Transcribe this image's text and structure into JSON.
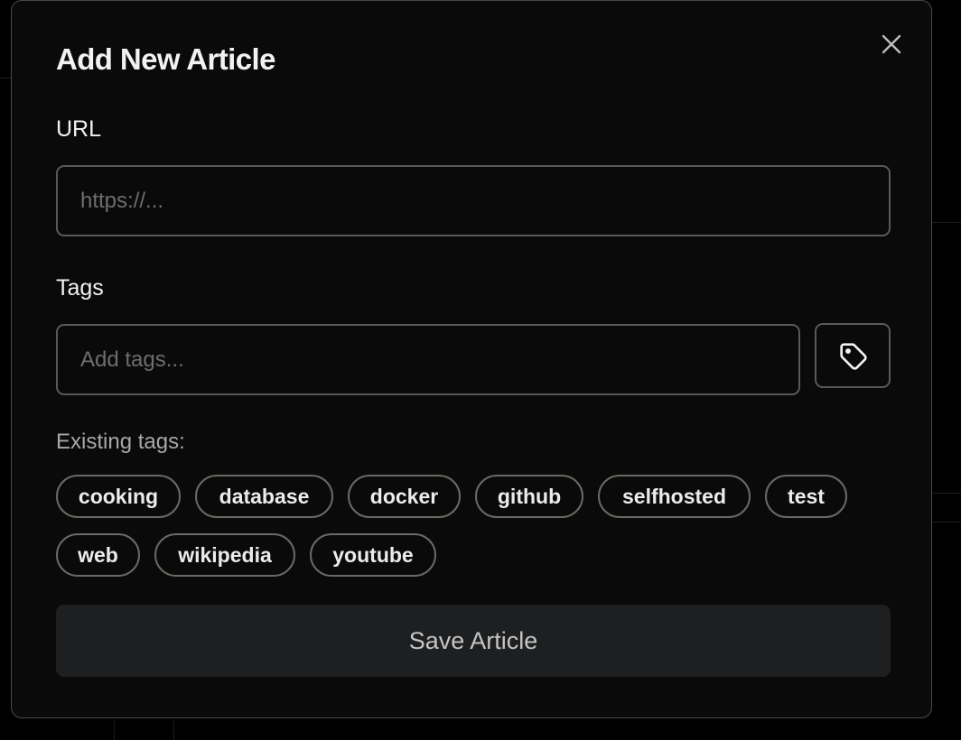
{
  "modal": {
    "title": "Add New Article",
    "url_label": "URL",
    "url_placeholder": "https://...",
    "url_value": "",
    "tags_label": "Tags",
    "tags_placeholder": "Add tags...",
    "tags_value": "",
    "existing_tags_label": "Existing tags:",
    "existing_tags": [
      "cooking",
      "database",
      "docker",
      "github",
      "selfhosted",
      "test",
      "web",
      "wikipedia",
      "youtube"
    ],
    "save_label": "Save Article",
    "icons": {
      "close": "close-icon",
      "tag": "tag-icon"
    }
  },
  "colors": {
    "background": "#000000",
    "modal_background": "#0a0a0a",
    "border": "#5a5a54",
    "text": "#f2f2f2",
    "muted_text": "#a8a8a8",
    "save_button": "#1e1f21"
  }
}
